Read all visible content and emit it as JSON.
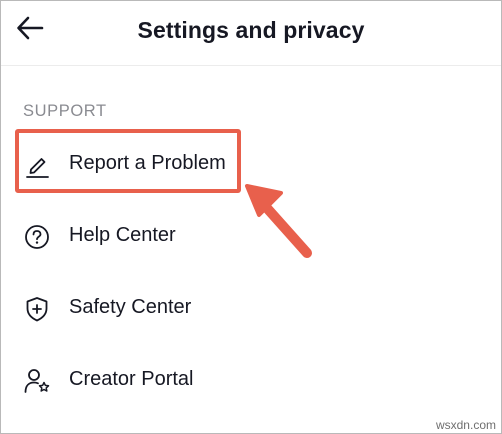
{
  "header": {
    "title": "Settings and privacy",
    "back_icon": "arrow-left-icon"
  },
  "support": {
    "section_label": "SUPPORT",
    "items": [
      {
        "label": "Report a Problem",
        "icon": "pencil-edit-icon"
      },
      {
        "label": "Help Center",
        "icon": "question-circle-icon"
      },
      {
        "label": "Safety Center",
        "icon": "shield-plus-icon"
      },
      {
        "label": "Creator Portal",
        "icon": "person-star-icon"
      }
    ]
  },
  "annotation": {
    "highlight_color": "#e8604c",
    "arrow_color": "#e8604c"
  },
  "watermark": "wsxdn.com"
}
